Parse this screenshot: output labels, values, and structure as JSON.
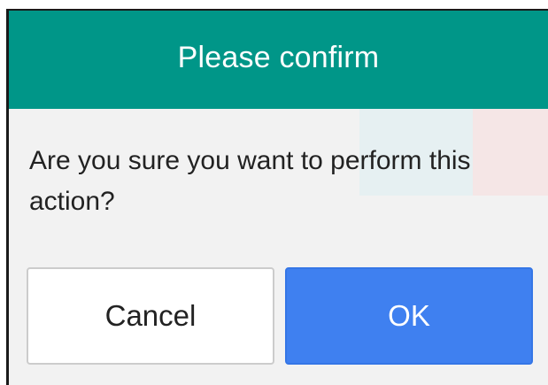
{
  "dialog": {
    "title": "Please confirm",
    "message": "Are you sure you want to perform this action?",
    "cancel_label": "Cancel",
    "ok_label": "OK"
  },
  "colors": {
    "header_bg": "#009688",
    "ok_button_bg": "#3f80f0",
    "dialog_bg": "#f2f2f2"
  }
}
